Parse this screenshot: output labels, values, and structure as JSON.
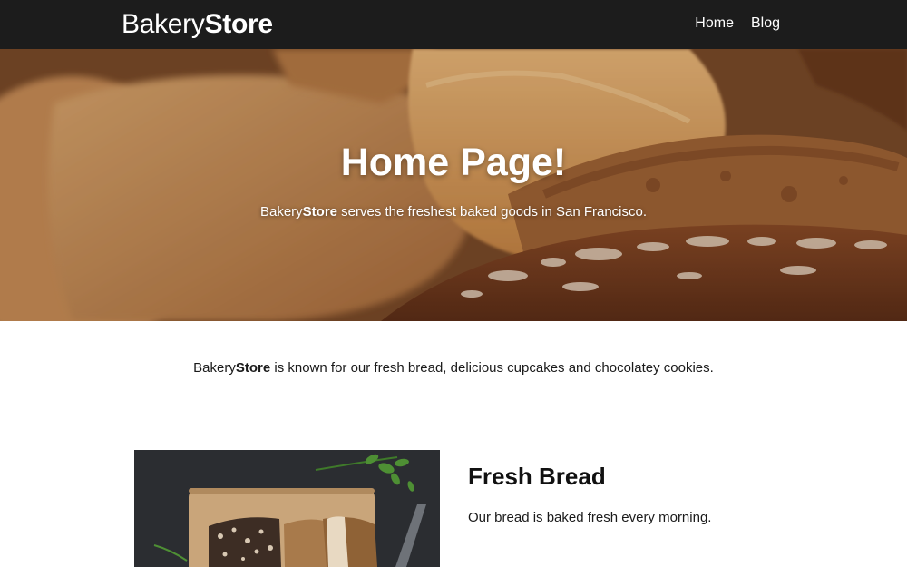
{
  "brand": {
    "light": "Bakery",
    "bold": "Store"
  },
  "nav": {
    "items": [
      {
        "label": "Home"
      },
      {
        "label": "Blog"
      }
    ]
  },
  "hero": {
    "title": "Home Page!",
    "subtitle_brand_light": "Bakery",
    "subtitle_brand_bold": "Store",
    "subtitle_rest": " serves the freshest baked goods in San Francisco."
  },
  "intro": {
    "brand_light": "Bakery",
    "brand_bold": "Store",
    "rest": " is known for our fresh bread, delicious cupcakes and chocolatey cookies."
  },
  "feature": {
    "title": "Fresh Bread",
    "text": "Our bread is baked fresh every morning."
  },
  "colors": {
    "navbar": "#1c1c1c",
    "hero_bread": "#c98b52",
    "text": "#1a1a1a"
  }
}
